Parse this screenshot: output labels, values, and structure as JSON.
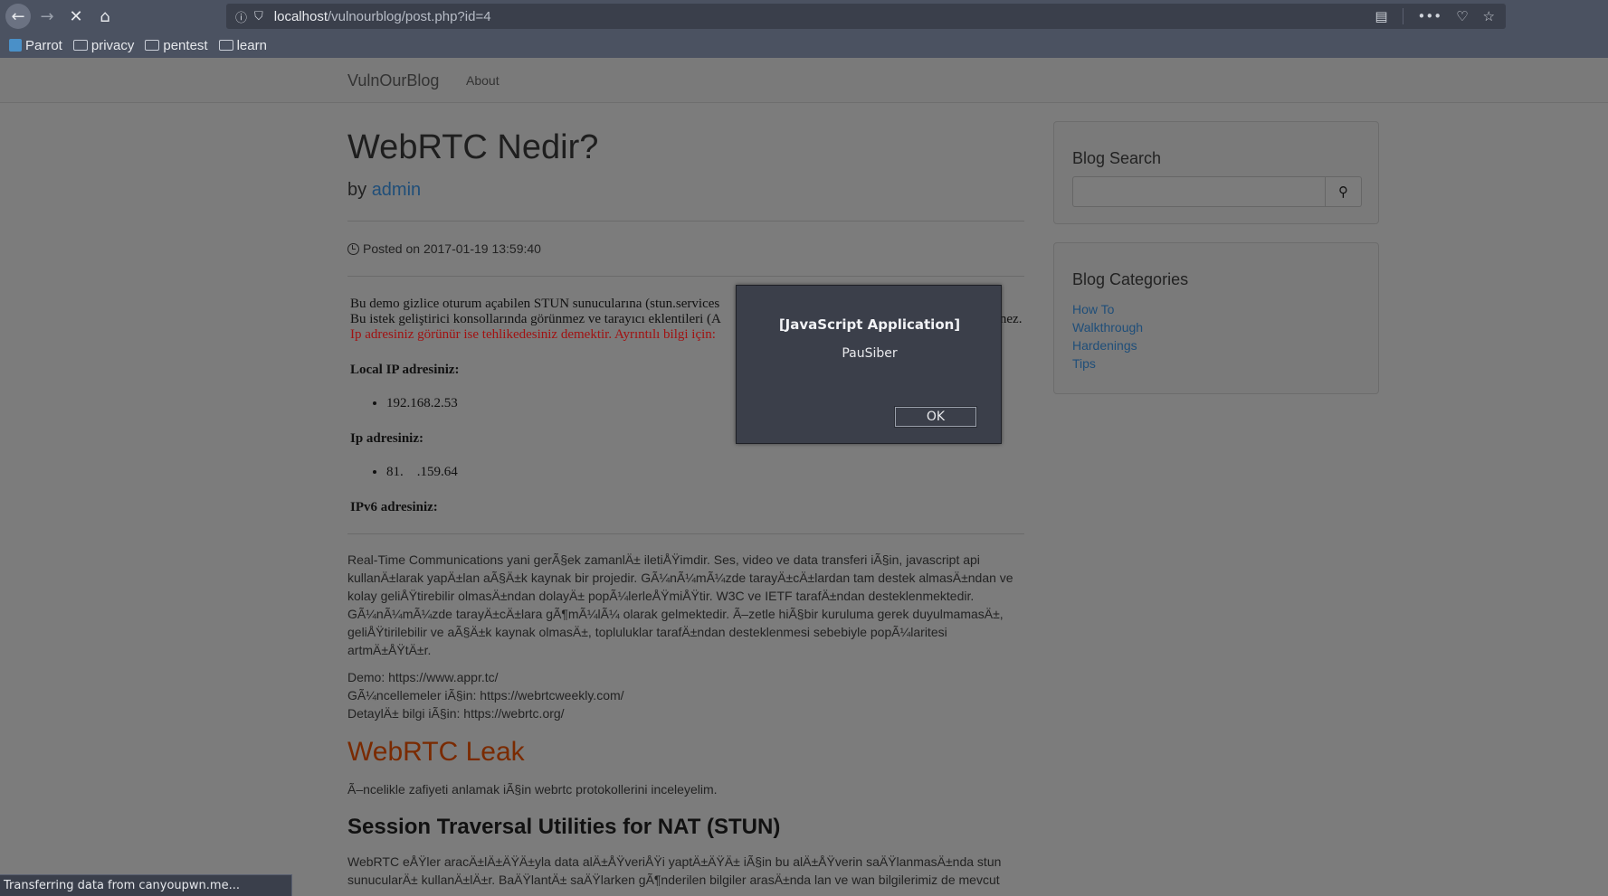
{
  "browser": {
    "url_host": "localhost",
    "url_path": "/vulnourblog/post.php?id=4",
    "back_icon": "arrow-left-icon",
    "forward_icon": "arrow-right-icon",
    "stop_icon": "close-icon",
    "home_icon": "home-icon",
    "bookmarks": [
      {
        "label": "Parrot",
        "icon": "parrot-icon"
      },
      {
        "label": "privacy",
        "icon": "folder-icon"
      },
      {
        "label": "pentest",
        "icon": "folder-icon"
      },
      {
        "label": "learn",
        "icon": "folder-icon"
      }
    ],
    "status_text": "Transferring data from canyoupwn.me..."
  },
  "site": {
    "brand": "VulnOurBlog",
    "nav_about": "About"
  },
  "post": {
    "title": "WebRTC Nedir?",
    "by_prefix": "by",
    "author": "admin",
    "posted": "Posted on 2017-01-19 13:59:40",
    "demo_line1": "Bu demo gizlice oturum açabilen STUN sunucularına (stun.services",
    "demo_line2_a": "Bu istek geliştirici konsollarında görünmez ve tarayıcı eklentileri (A",
    "demo_line2_b": "nez.",
    "demo_red": "Ip adresiniz görünür ise tehlikedesiniz demektir. Ayrıntılı bilgi için:",
    "local_ip_label": "Local IP adresiniz:",
    "local_ip": "192.168.2.53",
    "ip_label": "Ip adresiniz:",
    "ip_value": "81.    .159.64",
    "ipv6_label": "IPv6 adresiniz:",
    "paragraph1": "Real-Time Communications yani gerÃ§ek zamanlÄ± iletiÅŸimdir. Ses, video ve data transferi iÃ§in, javascript api kullanÄ±larak yapÄ±lan aÃ§Ä±k kaynak bir projedir. GÃ¼nÃ¼mÃ¼zde tarayÄ±cÄ±lardan tam destek almasÄ±ndan ve kolay geliÅŸtirebilir olmasÄ±ndan dolayÄ± popÃ¼lerleÅŸmiÅŸtir. W3C ve IETF tarafÄ±ndan desteklenmektedir. GÃ¼nÃ¼mÃ¼zde tarayÄ±cÄ±lara gÃ¶mÃ¼lÃ¼ olarak gelmektedir. Ã–zetle hiÃ§bir kuruluma gerek duyulmamasÄ±, geliÅŸtirilebilir ve aÃ§Ä±k kaynak olmasÄ±, topluluklar tarafÄ±ndan desteklenmesi sebebiyle popÃ¼laritesi artmÄ±ÅŸtÄ±r.",
    "link_demo": "Demo: https://www.appr.tc/",
    "link_updates": "GÃ¼ncellemeler iÃ§in: https://webrtcweekly.com/",
    "link_detail": "DetaylÄ± bilgi iÃ§in: https://webrtc.org/",
    "h_leak": "WebRTC Leak",
    "leak_intro": "Ã–ncelikle zafiyeti anlamak iÃ§in webrtc protokollerini inceleyelim.",
    "h_stun": "Session Traversal Utilities for NAT (STUN)",
    "stun_line1": "WebRTC eÅŸler aracÄ±lÄ±ÄŸÄ±yla data alÄ±ÅŸveriÅŸi yaptÄ±ÄŸÄ± iÃ§in bu alÄ±ÅŸverin saÄŸlanmasÄ±nda stun",
    "stun_line2": "sunucularÄ± kullanÄ±lÄ±r. BaÄŸlantÄ± saÄŸlarken gÃ¶nderilen bilgiler arasÄ±nda lan ve wan bilgilerimiz de mevcut"
  },
  "sidebar": {
    "search_title": "Blog Search",
    "search_icon": "search-icon",
    "categories_title": "Blog Categories",
    "categories": [
      "How To",
      "Walkthrough",
      "Hardenings",
      "Tips"
    ]
  },
  "dialog": {
    "title": "[JavaScript Application]",
    "message": "PauSiber",
    "ok_label": "OK"
  }
}
